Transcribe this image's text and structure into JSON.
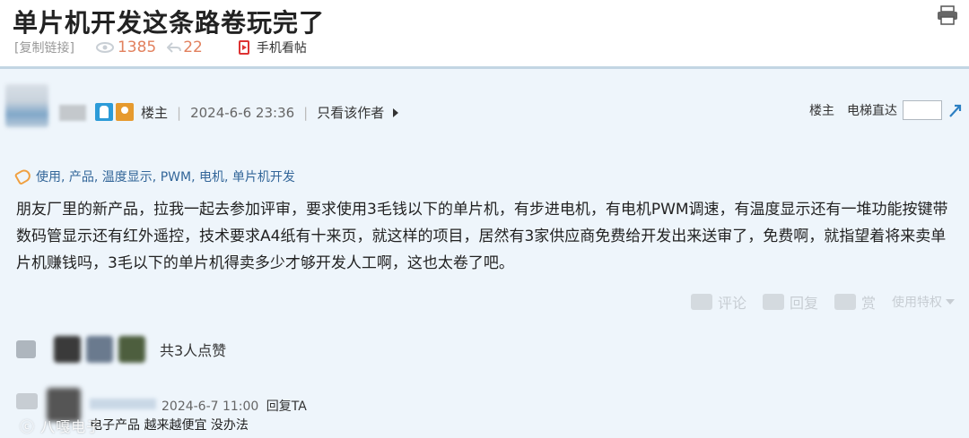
{
  "header": {
    "title": "单片机开发这条路卷玩完了",
    "copy_link": "[复制链接]",
    "views": "1385",
    "replies": "22",
    "mobile_view": "手机看帖"
  },
  "post": {
    "role": "楼主",
    "time": "2024-6-6 23:36",
    "only_author": "只看该作者",
    "floor_label": "楼主",
    "elevator_label": "电梯直达",
    "tags": "使用, 产品, 温度显示, PWM, 电机, 单片机开发",
    "paragraph": "朋友厂里的新产品，拉我一起去参加评审，要求使用3毛钱以下的单片机，有步进电机，有电机PWM调速，有温度显示还有一堆功能按键带数码管显示还有红外遥控，技术要求A4纸有十来页，就这样的项目，居然有3家供应商免费给开发出来送审了，免费啊，就指望着将来卖单片机赚钱吗，3毛以下的单片机得卖多少才够开发人工啊，这也太卷了吧。",
    "actions": {
      "comment": "评论",
      "reply": "回复",
      "reward": "赏",
      "privilege": "使用特权"
    },
    "likes_text": "共3人点赞"
  },
  "comment": {
    "time": "2024-6-7 11:00",
    "reply_ta": "回复TA",
    "text": "电子产品 越来越便宜 没办法"
  },
  "watermark": "ⓒ 八嘎电子",
  "colors": {
    "post_bg": "#eef5fb",
    "accent_count": "#e2815e",
    "tag_link": "#336699"
  }
}
